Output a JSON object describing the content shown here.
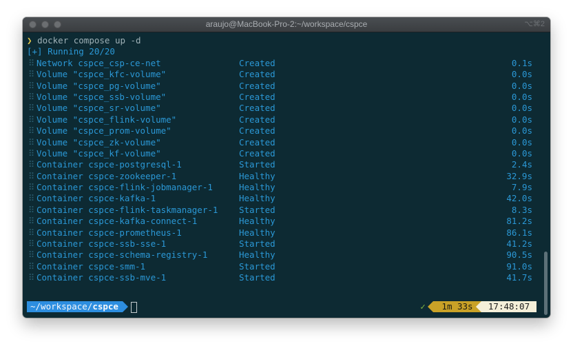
{
  "window": {
    "title": "araujo@MacBook-Pro-2:~/workspace/cspce",
    "shortcut": "⌥⌘2"
  },
  "terminal": {
    "prompt_symbol": "❯",
    "command": "docker compose up -d",
    "running": "[+] Running 20/20",
    "rows": [
      {
        "name": "Network cspce_csp-ce-net",
        "status": "Created",
        "time": "0.1s"
      },
      {
        "name": "Volume \"cspce_kfc-volume\"",
        "status": "Created",
        "time": "0.0s"
      },
      {
        "name": "Volume \"cspce_pg-volume\"",
        "status": "Created",
        "time": "0.0s"
      },
      {
        "name": "Volume \"cspce_ssb-volume\"",
        "status": "Created",
        "time": "0.0s"
      },
      {
        "name": "Volume \"cspce_sr-volume\"",
        "status": "Created",
        "time": "0.0s"
      },
      {
        "name": "Volume \"cspce_flink-volume\"",
        "status": "Created",
        "time": "0.0s"
      },
      {
        "name": "Volume \"cspce_prom-volume\"",
        "status": "Created",
        "time": "0.0s"
      },
      {
        "name": "Volume \"cspce_zk-volume\"",
        "status": "Created",
        "time": "0.0s"
      },
      {
        "name": "Volume \"cspce_kf-volume\"",
        "status": "Created",
        "time": "0.0s"
      },
      {
        "name": "Container cspce-postgresql-1",
        "status": "Started",
        "time": "2.4s"
      },
      {
        "name": "Container cspce-zookeeper-1",
        "status": "Healthy",
        "time": "32.9s"
      },
      {
        "name": "Container cspce-flink-jobmanager-1",
        "status": "Healthy",
        "time": "7.9s"
      },
      {
        "name": "Container cspce-kafka-1",
        "status": "Healthy",
        "time": "42.0s"
      },
      {
        "name": "Container cspce-flink-taskmanager-1",
        "status": "Started",
        "time": "8.3s"
      },
      {
        "name": "Container cspce-kafka-connect-1",
        "status": "Healthy",
        "time": "81.2s"
      },
      {
        "name": "Container cspce-prometheus-1",
        "status": "Healthy",
        "time": "86.1s"
      },
      {
        "name": "Container cspce-ssb-sse-1",
        "status": "Started",
        "time": "41.2s"
      },
      {
        "name": "Container cspce-schema-registry-1",
        "status": "Healthy",
        "time": "90.5s"
      },
      {
        "name": "Container cspce-smm-1",
        "status": "Started",
        "time": "91.0s"
      },
      {
        "name": "Container cspce-ssb-mve-1",
        "status": "Started",
        "time": "41.7s"
      }
    ],
    "prompt": {
      "dir_prefix": "~/workspace/",
      "dir_current": "cspce",
      "check": "✓",
      "duration": "1m 33s",
      "clock": "17:48:07"
    }
  },
  "colors": {
    "background": "#0d2a33",
    "text_blue": "#2b98d6",
    "prompt_yellow": "#e3c84a",
    "dir_segment": "#2d8ee0",
    "duration_segment": "#c9a227",
    "clock_segment": "#f4efd9",
    "check_green": "#7fb542"
  }
}
